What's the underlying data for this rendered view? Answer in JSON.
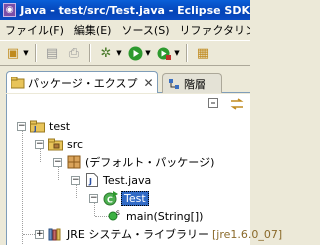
{
  "window": {
    "title": "Java - test/src/Test.java - Eclipse SDK"
  },
  "menu": [
    "ファイル(F)",
    "編集(E)",
    "ソース(S)",
    "リファクタリング(T)"
  ],
  "tabs": {
    "active": "パッケージ・エクスプ",
    "inactive": "階層"
  },
  "tree": {
    "project": "test",
    "src": "src",
    "package": "(デフォルト・パッケージ)",
    "file": "Test.java",
    "class": "Test",
    "method": "main(String[])",
    "library": "JRE システム・ライブラリー",
    "library_suffix": "[jre1.6.0_07]"
  },
  "colors": {
    "selection": "#316ac5",
    "title_bar": "#0443b7"
  }
}
